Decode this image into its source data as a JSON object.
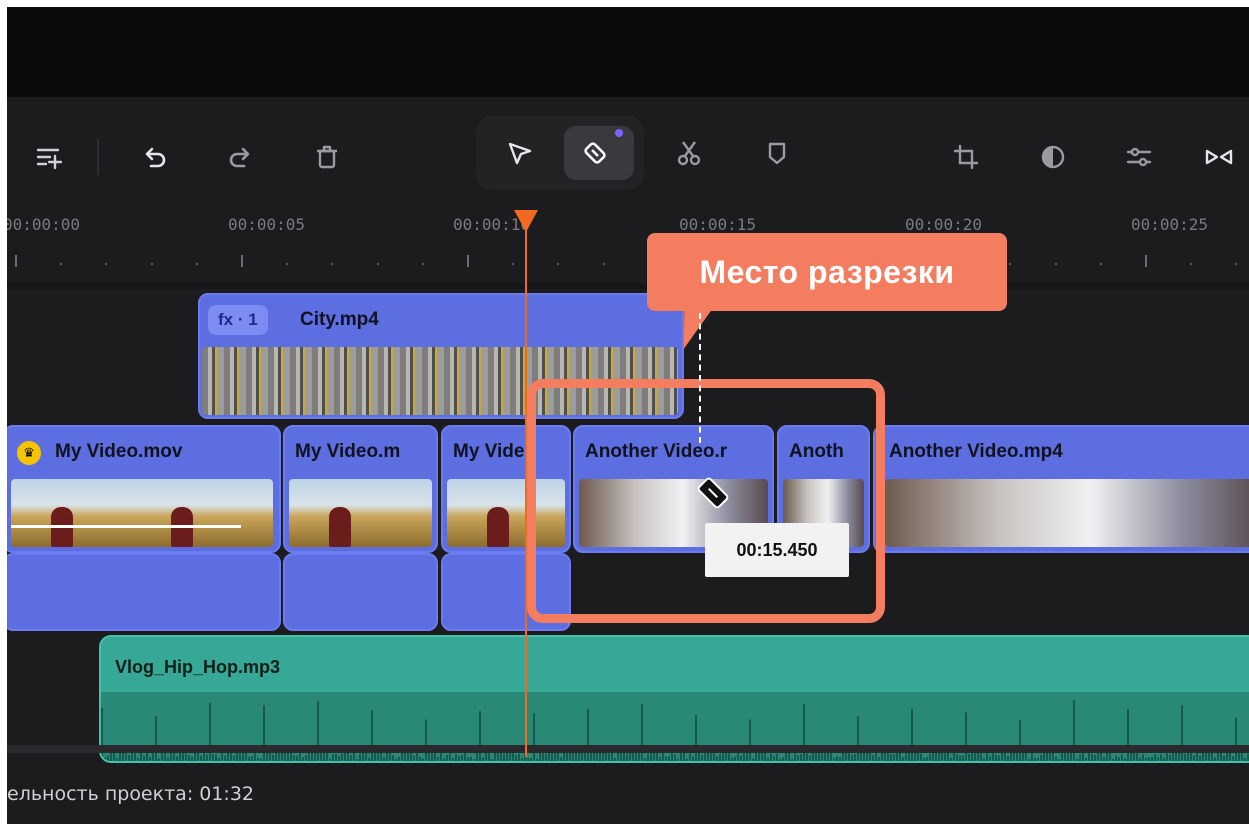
{
  "toolbar": {
    "left_icons": [
      "add-track-icon",
      "undo-icon",
      "redo-icon",
      "trash-icon"
    ],
    "center_tools": [
      "select-arrow-icon",
      "razor-blade-icon",
      "scissors-icon",
      "marker-icon"
    ],
    "right_icons": [
      "crop-icon",
      "color-icon",
      "adjust-icon",
      "transition-icon"
    ]
  },
  "ruler": {
    "labels": [
      "00:00:00",
      "00:00:05",
      "00:00:10",
      "00:00:15",
      "00:00:20",
      "00:00:25"
    ]
  },
  "tracks": {
    "overlay_clip": {
      "badge": "fx · 1",
      "name": "City.mp4"
    },
    "video_clips": [
      {
        "name": "My Video.mov"
      },
      {
        "name": "My Video.m"
      },
      {
        "name": "My Video"
      },
      {
        "name": "Another Video.r"
      },
      {
        "name": "Anoth"
      },
      {
        "name": "Another Video.mp4"
      }
    ],
    "audio_clip": {
      "name": "Vlog_Hip_Hop.mp3"
    }
  },
  "annotation": {
    "callout": "Место разрезки",
    "timecode": "00:15.450"
  },
  "status": {
    "duration": "ельность проекта: 01:32"
  },
  "colors": {
    "accent": "#f26a21",
    "callout": "#f47c5f",
    "video_clip": "#5d6ee0",
    "audio_clip": "#37a895"
  }
}
